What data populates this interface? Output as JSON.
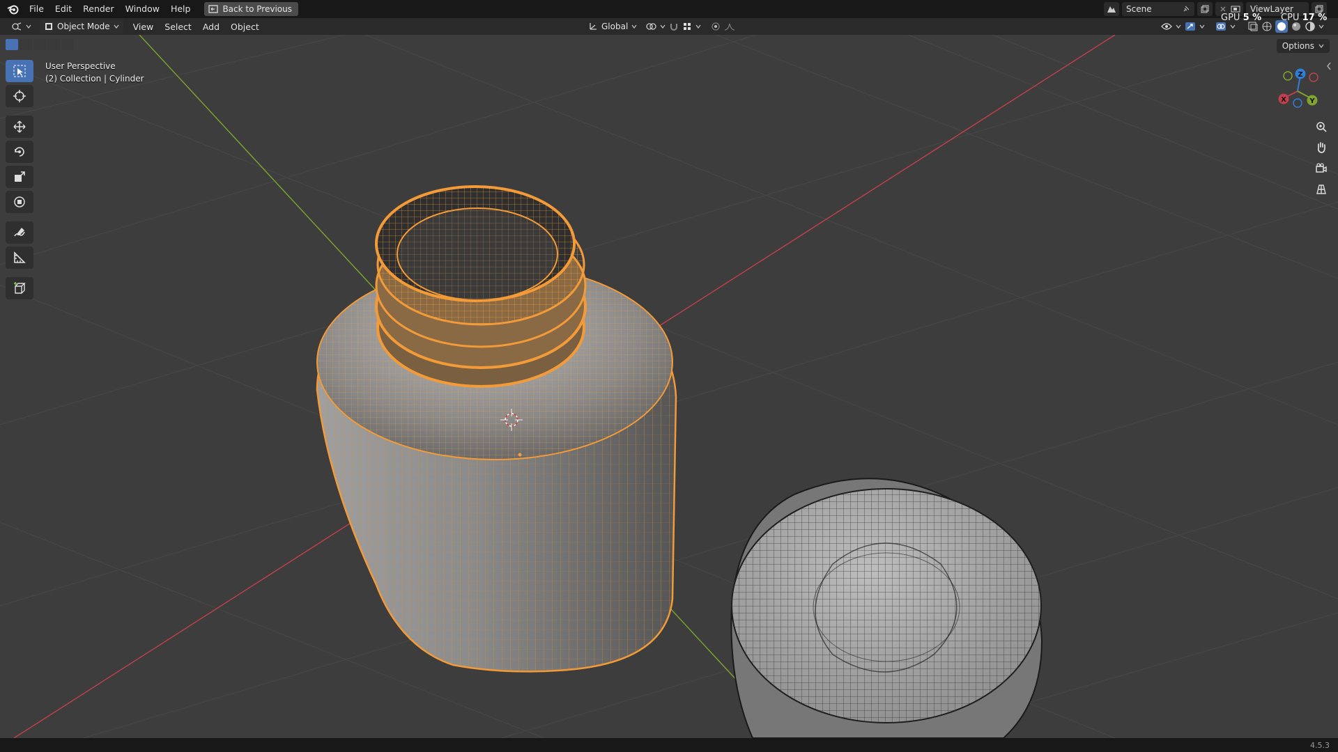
{
  "topbar": {
    "menus": [
      "File",
      "Edit",
      "Render",
      "Window",
      "Help"
    ],
    "back_button": "Back to Previous",
    "scene_name": "Scene",
    "view_layer": "ViewLayer",
    "gpu_label": "GPU",
    "gpu_value": "5 %",
    "cpu_label": "CPU",
    "cpu_value": "17 %"
  },
  "header": {
    "mode": "Object Mode",
    "menus": [
      "View",
      "Select",
      "Add",
      "Object"
    ],
    "orientation": "Global"
  },
  "viewport": {
    "perspective": "User Perspective",
    "collection": "(2) Collection | Cylinder",
    "options": "Options",
    "gizmo_axes": {
      "x": "X",
      "y": "Y",
      "z": "Z"
    }
  },
  "tools": [
    "select-box",
    "cursor",
    "move",
    "rotate",
    "scale",
    "transform",
    "annotate",
    "measure",
    "add-cube"
  ],
  "statusbar": {
    "version": "4.5.3"
  },
  "colors": {
    "selection_orange": "#f29b38",
    "x_axis_red": "#c2404e",
    "y_axis_green": "#7ea52e",
    "z_axis_blue": "#2f7ed8",
    "active_blue": "#4772b3"
  }
}
